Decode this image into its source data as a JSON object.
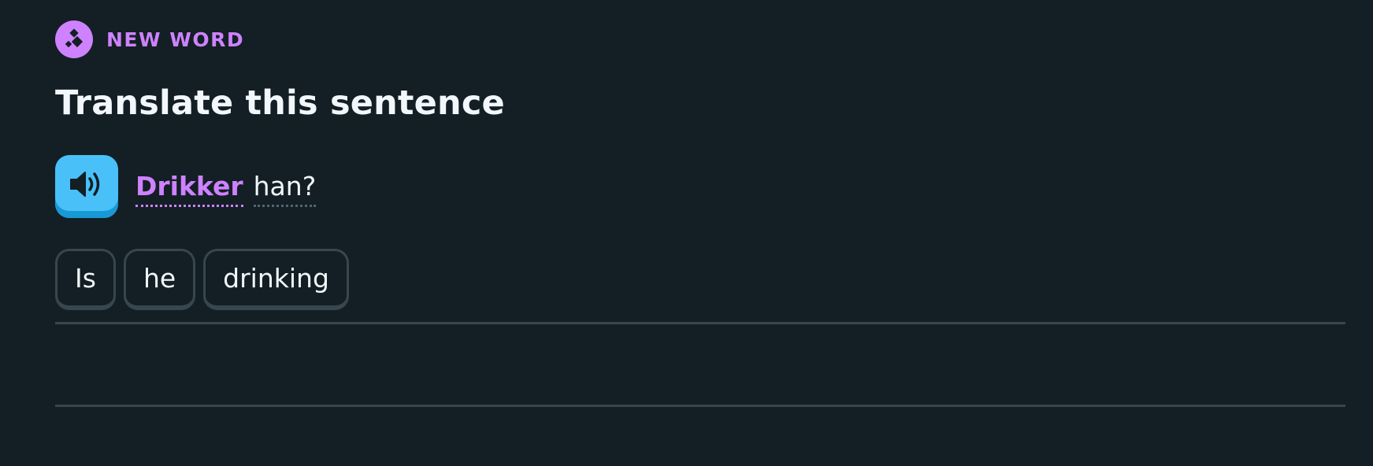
{
  "challenge": {
    "badge_label": "NEW WORD",
    "badge_icon": "sparkle-diamond-icon",
    "title": "Translate this sentence"
  },
  "prompt": {
    "speaker_icon": "speaker-icon",
    "new_word": "Drikker",
    "rest_word": "han?"
  },
  "answer": {
    "chips": [
      "Is",
      "he",
      "drinking"
    ]
  },
  "colors": {
    "background": "#131f24",
    "accent_purple": "#ce82ff",
    "speaker_blue": "#49c0f8",
    "border": "#37464f"
  }
}
